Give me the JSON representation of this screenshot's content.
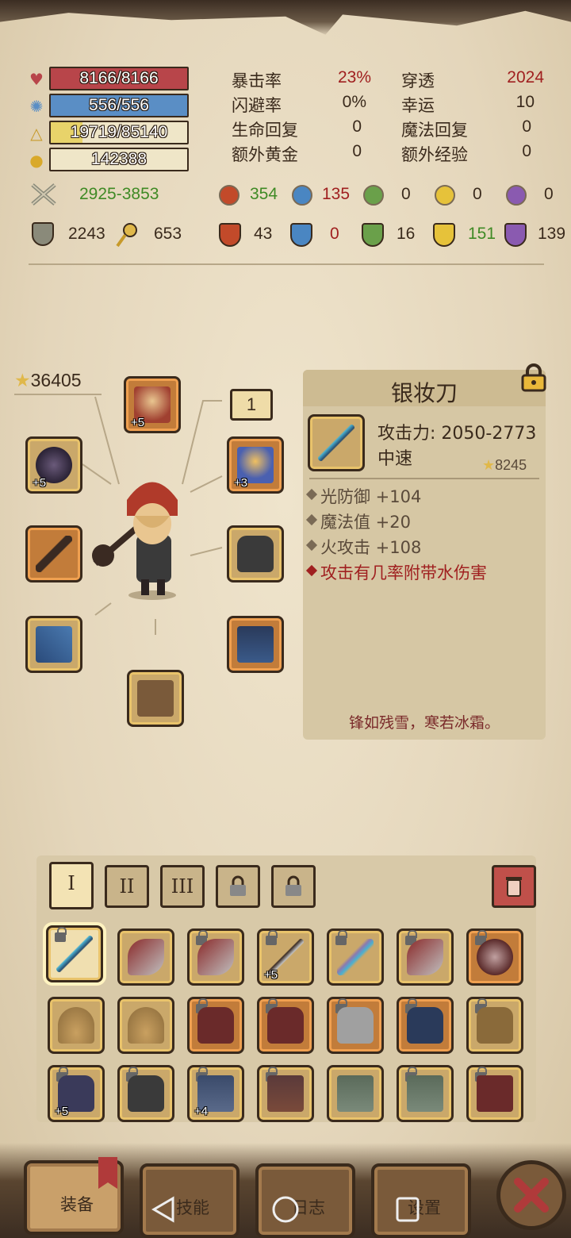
{
  "stats": {
    "hp": "8166/8166",
    "mp": "556/556",
    "xp": "19719/85140",
    "xp_fraction": 0.2316,
    "gold": "142388"
  },
  "attributes": [
    {
      "label": "暴击率",
      "value": "23%",
      "label2": "穿透",
      "value2": "2024"
    },
    {
      "label": "闪避率",
      "value": "0%",
      "label2": "幸运",
      "value2": "10"
    },
    {
      "label": "生命回复",
      "value": "0",
      "label2": "魔法回复",
      "value2": "0"
    },
    {
      "label": "额外黄金",
      "value": "0",
      "label2": "额外经验",
      "value2": "0"
    }
  ],
  "attack": {
    "range": "2925-3853",
    "fire": "354",
    "water": "135",
    "nature": "0",
    "light": "0",
    "dark": "0"
  },
  "defense": {
    "armor": "2243",
    "magic": "653",
    "fire": "43",
    "water": "0",
    "nature": "16",
    "light": "151",
    "dark": "139"
  },
  "character": {
    "score": "36405",
    "slot_badge": "1"
  },
  "item": {
    "name": "银妆刀",
    "attack": "攻击力: 2050-2773",
    "speed": "中速",
    "score": "8245",
    "props": [
      "光防御 +104",
      "魔法值 +20",
      "火攻击 +108"
    ],
    "special": "攻击有几率附带水伤害",
    "flavor": "锋如残雪，寒若冰霜。"
  },
  "tabs": [
    "I",
    "II",
    "III"
  ],
  "nav": {
    "equip": "装备",
    "skill": "技能",
    "log": "日志",
    "settings": "设置"
  },
  "colors": {
    "hp": "#b8454a",
    "mp": "#5a8ec5",
    "xp": "#e8d36a",
    "red_text": "#a02020",
    "green_text": "#3f8a25"
  }
}
